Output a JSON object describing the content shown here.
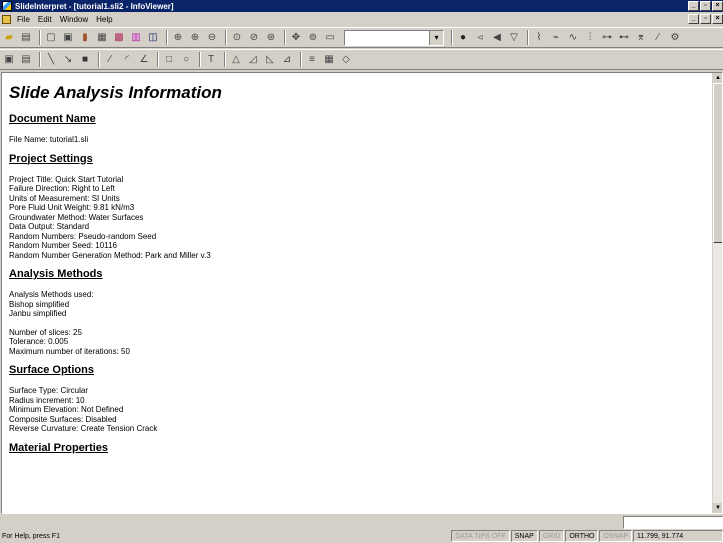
{
  "window": {
    "title": "SlideInterpret - [tutorial1.sli2 - InfoViewer]",
    "minimize": "_",
    "maximize": "▫",
    "close": "×"
  },
  "menu": [
    "File",
    "Edit",
    "Window",
    "Help"
  ],
  "document": {
    "title": "Slide Analysis Information",
    "sections": [
      {
        "heading": "Document Name",
        "lines": [
          "File Name: tutorial1.sli"
        ]
      },
      {
        "heading": "Project Settings",
        "lines": [
          "Project Title: Quick Start Tutorial",
          "Failure Direction: Right to Left",
          "Units of Measurement: SI Units",
          "Pore Fluid Unit Weight: 9.81 kN/m3",
          "Groundwater Method: Water Surfaces",
          "Data Output: Standard",
          "Random Numbers: Pseudo-random Seed",
          "Random Number Seed: 10116",
          "Random Number Generation Method: Park and Miller v.3"
        ]
      },
      {
        "heading": "Analysis Methods",
        "lines": [
          "Analysis Methods used:",
          "Bishop simplified",
          "Janbu simplified"
        ],
        "lines2": [
          "Number of slices: 25",
          "Tolerance: 0.005",
          "Maximum number of iterations: 50"
        ]
      },
      {
        "heading": "Surface Options",
        "lines": [
          "Surface Type: Circular",
          "Radius increment: 10",
          "Minimum Elevation: Not Defined",
          "Composite Surfaces: Disabled",
          "Reverse Curvature: Create Tension Crack"
        ]
      },
      {
        "heading": "Material Properties",
        "lines": []
      }
    ]
  },
  "status": {
    "help": "For Help, press F1",
    "data_tips": "DATA TIPS OFF",
    "snap": "SNAP",
    "grid": "GRID",
    "ortho": "ORTHO",
    "osnap": "OSNAP",
    "coords": "11.799, 91.774"
  }
}
